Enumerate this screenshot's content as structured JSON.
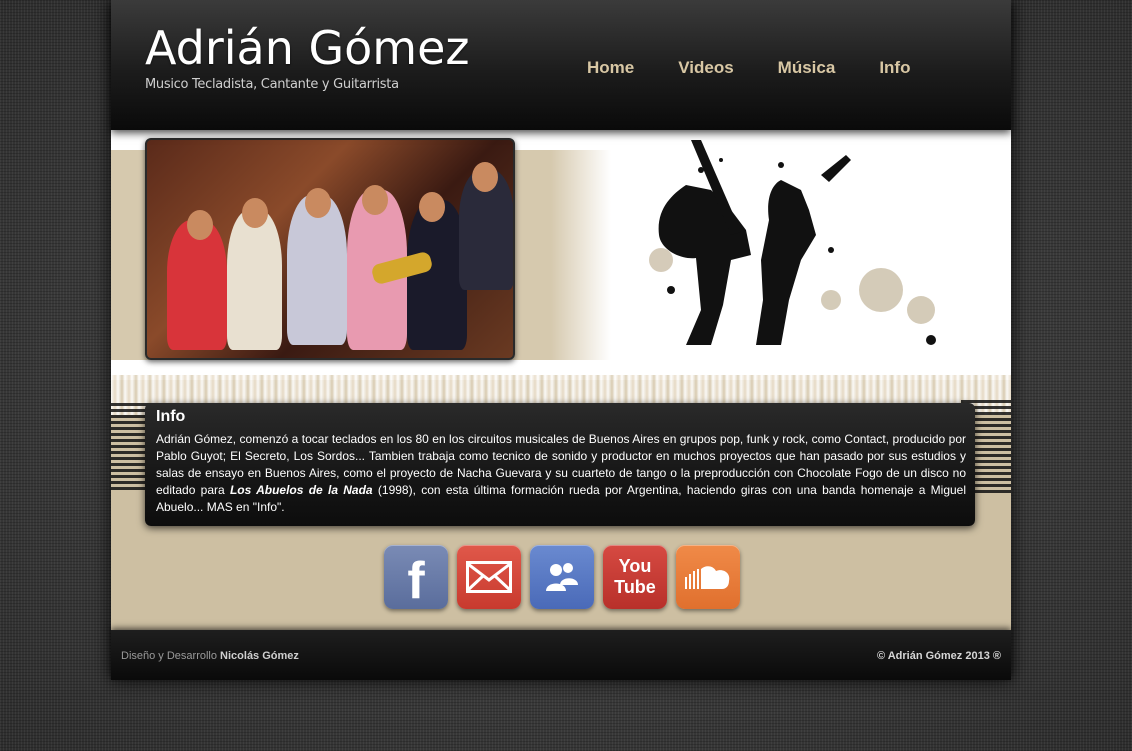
{
  "header": {
    "title": "Adrián Gómez",
    "subtitle": "Musico Tecladista, Cantante y Guitarrista"
  },
  "nav": {
    "items": [
      {
        "label": "Home"
      },
      {
        "label": "Videos"
      },
      {
        "label": "Música"
      },
      {
        "label": "Info"
      }
    ]
  },
  "info": {
    "title": "Info",
    "text_before": "Adrián Gómez, comenzó a tocar teclados en los 80 en los circuitos musicales de Buenos Aires en grupos pop, funk y rock, como Contact, producido por Pablo Guyot; El Secreto, Los Sordos... Tambien trabaja como tecnico de sonido y productor en muchos proyectos que han pasado por sus estudios y salas de ensayo en Buenos Aires, como el proyecto de Nacha Guevara y su cuarteto de tango o la preproducción con Chocolate Fogo de un disco no editado para ",
    "text_bold": "Los Abuelos de la Nada",
    "text_after": " (1998), con esta última formación rueda por Argentina, haciendo giras con una banda homenaje a Miguel Abuelo... MAS en \"Info\"."
  },
  "social": {
    "facebook_glyph": "f",
    "youtube_you": "You",
    "youtube_tube": "Tube"
  },
  "footer": {
    "design_prefix": "Diseño y Desarrollo",
    "design_author": "Nicolás Gómez",
    "copyright": "© Adrián Gómez 2013 ®"
  },
  "colors": {
    "nav_text": "#d8c7a4",
    "banner_beige": "#cdbfa2",
    "facebook": "#5a6d9c",
    "mail": "#c83a2e",
    "msn": "#4a6ab8",
    "youtube": "#b8302a",
    "soundcloud": "#e0702e"
  }
}
